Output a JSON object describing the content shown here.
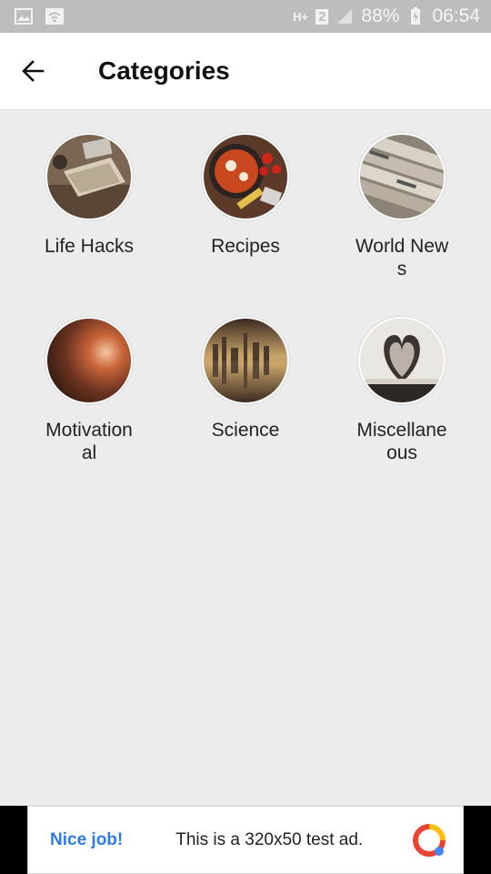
{
  "status_bar": {
    "network_type": "H+",
    "sim_slot": "2",
    "battery_percent": "88%",
    "time": "06:54",
    "icons": [
      "gallery-icon",
      "wifi-icon",
      "signal-icon",
      "battery-icon"
    ]
  },
  "header": {
    "title": "Categories",
    "back_icon": "arrow-left-icon"
  },
  "categories": [
    {
      "label": "Life Hacks",
      "image": "notebook-desk-photo"
    },
    {
      "label": "Recipes",
      "image": "food-pan-photo"
    },
    {
      "label": "World News",
      "image": "newspapers-photo"
    },
    {
      "label": "Motivational",
      "image": "light-burst-photo"
    },
    {
      "label": "Science",
      "image": "city-reflection-photo"
    },
    {
      "label": "Miscellaneous",
      "image": "book-heart-photo"
    }
  ],
  "ad": {
    "badge": "Nice job!",
    "text": "This is a 320x50 test ad.",
    "logo": "ad-logo-icon"
  },
  "colors": {
    "background": "#ececec",
    "status_bar": "#bdbdbd",
    "app_bar": "#ffffff",
    "ad_accent": "#2d7be5"
  }
}
